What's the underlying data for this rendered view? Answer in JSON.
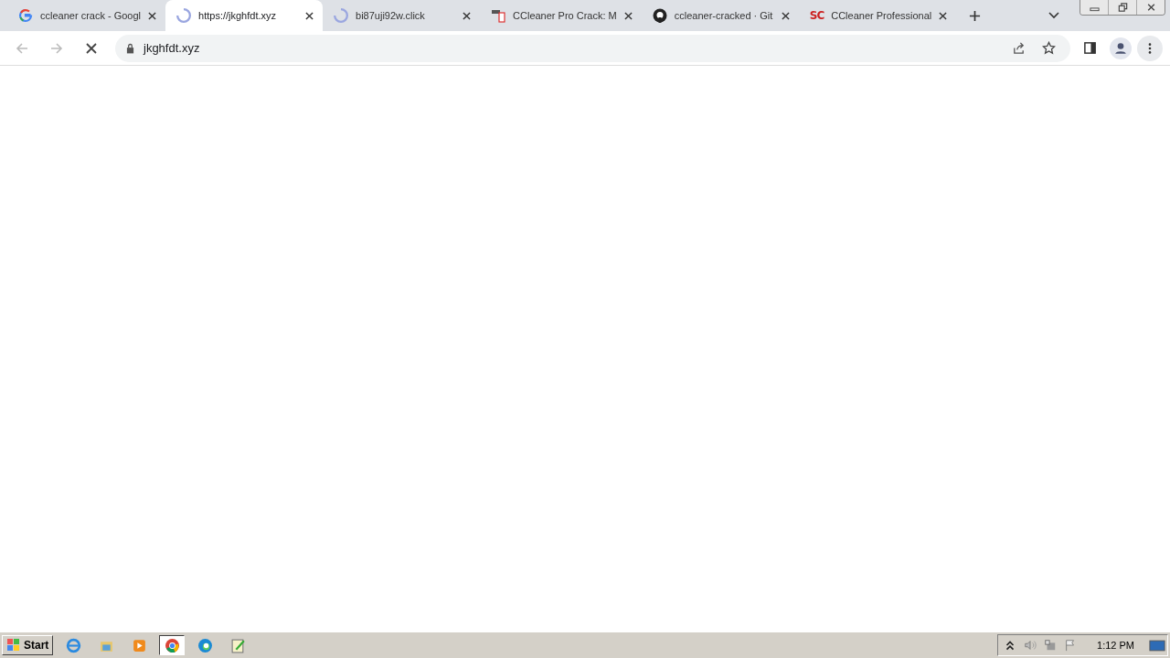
{
  "tabs": [
    {
      "kind": "google",
      "title": "ccleaner crack - Googl",
      "selected": false
    },
    {
      "kind": "loading",
      "title": "https://jkghfdt.xyz",
      "selected": true
    },
    {
      "kind": "loading",
      "title": "bi87uji92w.click",
      "selected": false
    },
    {
      "kind": "document",
      "title": "CCleaner Pro Crack: M",
      "selected": false
    },
    {
      "kind": "github",
      "title": "ccleaner-cracked · Git",
      "selected": false
    },
    {
      "kind": "text",
      "favicon_text": "SC",
      "title": "CCleaner Professional",
      "selected": false
    }
  ],
  "address_bar": {
    "value": "jkghfdt.xyz",
    "loading": true
  },
  "taskbar": {
    "start_label": "Start",
    "items": [
      {
        "kind": "ie",
        "selected": false
      },
      {
        "kind": "folder",
        "selected": false
      },
      {
        "kind": "media",
        "selected": false
      },
      {
        "kind": "chrome",
        "selected": true
      },
      {
        "kind": "edge",
        "selected": false
      },
      {
        "kind": "notepad",
        "selected": false
      }
    ],
    "clock": "1:12 PM"
  }
}
